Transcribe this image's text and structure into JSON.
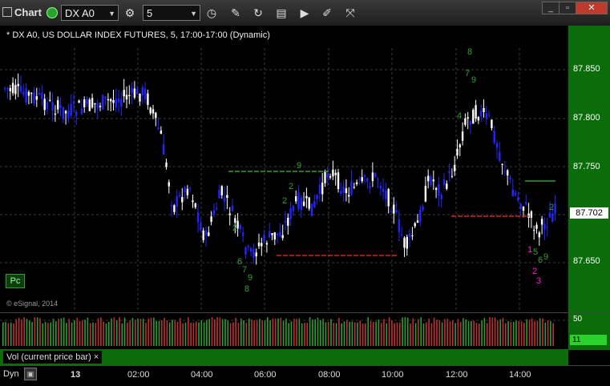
{
  "window": {
    "title": "Chart",
    "symbol": "DX A0",
    "interval": "5",
    "toolbar_icons": [
      "settings-icon",
      "clock-icon",
      "draw-icon",
      "refresh-icon",
      "replay-icon",
      "play-icon",
      "ruler-icon"
    ],
    "window_buttons": [
      "minimize",
      "restore",
      "close"
    ]
  },
  "chart": {
    "title": "* DX A0, US DOLLAR INDEX FUTURES, 5, 17:00-17:00 (Dynamic)",
    "pc_label": "Pc",
    "copyright": "© eSignal, 2014",
    "current_price": "87.702",
    "price_ticks": [
      "87.850",
      "87.800",
      "87.750",
      "87.700",
      "87.650"
    ],
    "time_ticks": [
      "13",
      "02:00",
      "04:00",
      "06:00",
      "08:00",
      "10:00",
      "12:00",
      "14:00"
    ],
    "colors": {
      "up": "#ffffff",
      "down": "#1f1fff",
      "bg": "#000000",
      "scale": "#0a6d0a"
    }
  },
  "volume": {
    "label": "Vol (current price bar)",
    "close_label": "×",
    "scale_top": "50",
    "current": "11"
  },
  "footer": {
    "mode": "Dyn"
  }
}
